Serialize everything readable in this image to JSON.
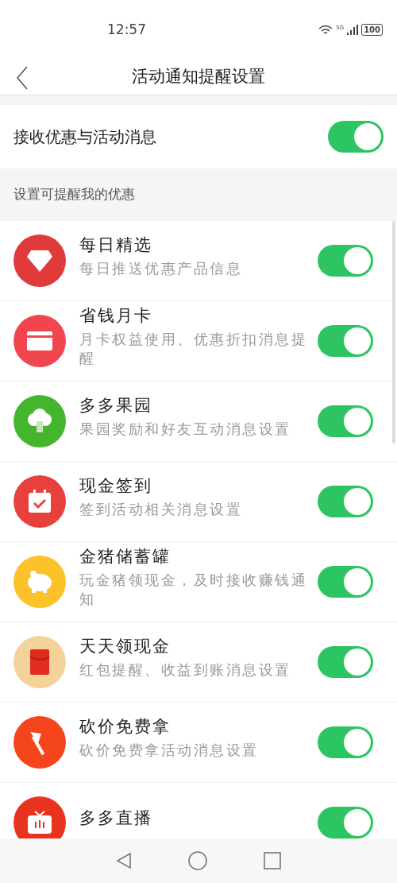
{
  "status_bar": {
    "time": "12:57",
    "network": "5G",
    "battery": "100"
  },
  "header": {
    "title": "活动通知提醒设置"
  },
  "master": {
    "label": "接收优惠与活动消息",
    "on": true
  },
  "section": {
    "title": "设置可提醒我的优惠"
  },
  "items": [
    {
      "kind": "diamond",
      "color": "#e03a3a",
      "title": "每日精选",
      "subtitle": "每日推送优惠产品信息",
      "on": true
    },
    {
      "kind": "card",
      "color": "#f2464f",
      "title": "省钱月卡",
      "subtitle": "月卡权益使用、优惠折扣消息提醒",
      "on": true
    },
    {
      "kind": "tree",
      "color": "#45b52e",
      "title": "多多果园",
      "subtitle": "果园奖励和好友互动消息设置",
      "on": true
    },
    {
      "kind": "calendar",
      "color": "#e8413d",
      "title": "现金签到",
      "subtitle": "签到活动相关消息设置",
      "on": true
    },
    {
      "kind": "pig",
      "color": "#fbc329",
      "title": "金猪储蓄罐",
      "subtitle": "玩金猪领现金，及时接收赚钱通知",
      "on": true
    },
    {
      "kind": "envelope",
      "color": "#f3d39a",
      "title": "天天领现金",
      "subtitle": "红包提醒、收益到账消息设置",
      "on": true
    },
    {
      "kind": "axe",
      "color": "#f5451c",
      "title": "砍价免费拿",
      "subtitle": "砍价免费拿活动消息设置",
      "on": true
    },
    {
      "kind": "tv",
      "color": "#e8341f",
      "title": "多多直播",
      "on": true
    }
  ]
}
